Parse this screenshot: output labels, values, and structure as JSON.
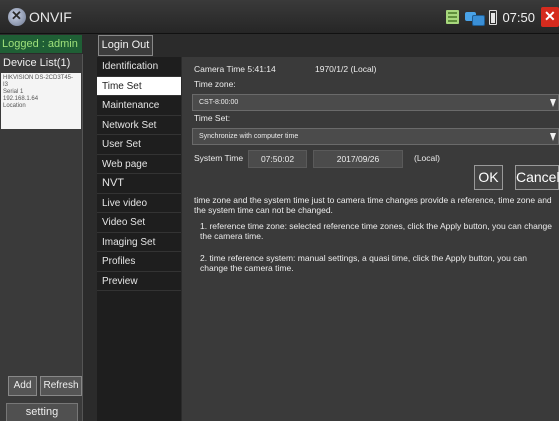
{
  "app": {
    "title": "ONVIF",
    "clock": "07:50"
  },
  "status": {
    "logged": "Logged : admin",
    "device_list": "Device List(1)"
  },
  "device": {
    "lines": [
      "HIKVISION DS-2CD3T45-",
      "I3",
      "Serial 1",
      "192.168.1.64",
      "Location"
    ]
  },
  "buttons": {
    "login_out": "Login Out",
    "add": "Add",
    "refresh": "Refresh",
    "setting": "setting",
    "ok": "OK",
    "cancel": "Cancel"
  },
  "menu": {
    "items": [
      "Identification",
      "Time Set",
      "Maintenance",
      "Network Set",
      "User Set",
      "Web page"
    ],
    "nvt_label": "NVT",
    "nvt_items": [
      "Live video",
      "Video Set",
      "Imaging Set",
      "Profiles",
      "Preview"
    ],
    "active": "Time Set"
  },
  "time_set": {
    "camera_time_label": "Camera Time 5:41:14",
    "camera_date": "1970/1/2 (Local)",
    "time_zone_label": "Time zone:",
    "time_zone_value": "CST-8:00:00",
    "time_set_label": "Time Set:",
    "time_set_value": "Synchronize with computer time",
    "system_time_label": "System Time",
    "system_time": "07:50:02",
    "system_date": "2017/09/26",
    "local_label": "(Local)"
  },
  "info": {
    "para1": "time zone and the system time just to camera time changes provide a reference, time zone and the system time can not be changed.",
    "para2": "1. reference time zone: selected reference time zones, click the Apply button, you can change the camera time.",
    "para3": "2. time reference system: manual settings, a quasi time, click the Apply button, you can change the camera time."
  }
}
